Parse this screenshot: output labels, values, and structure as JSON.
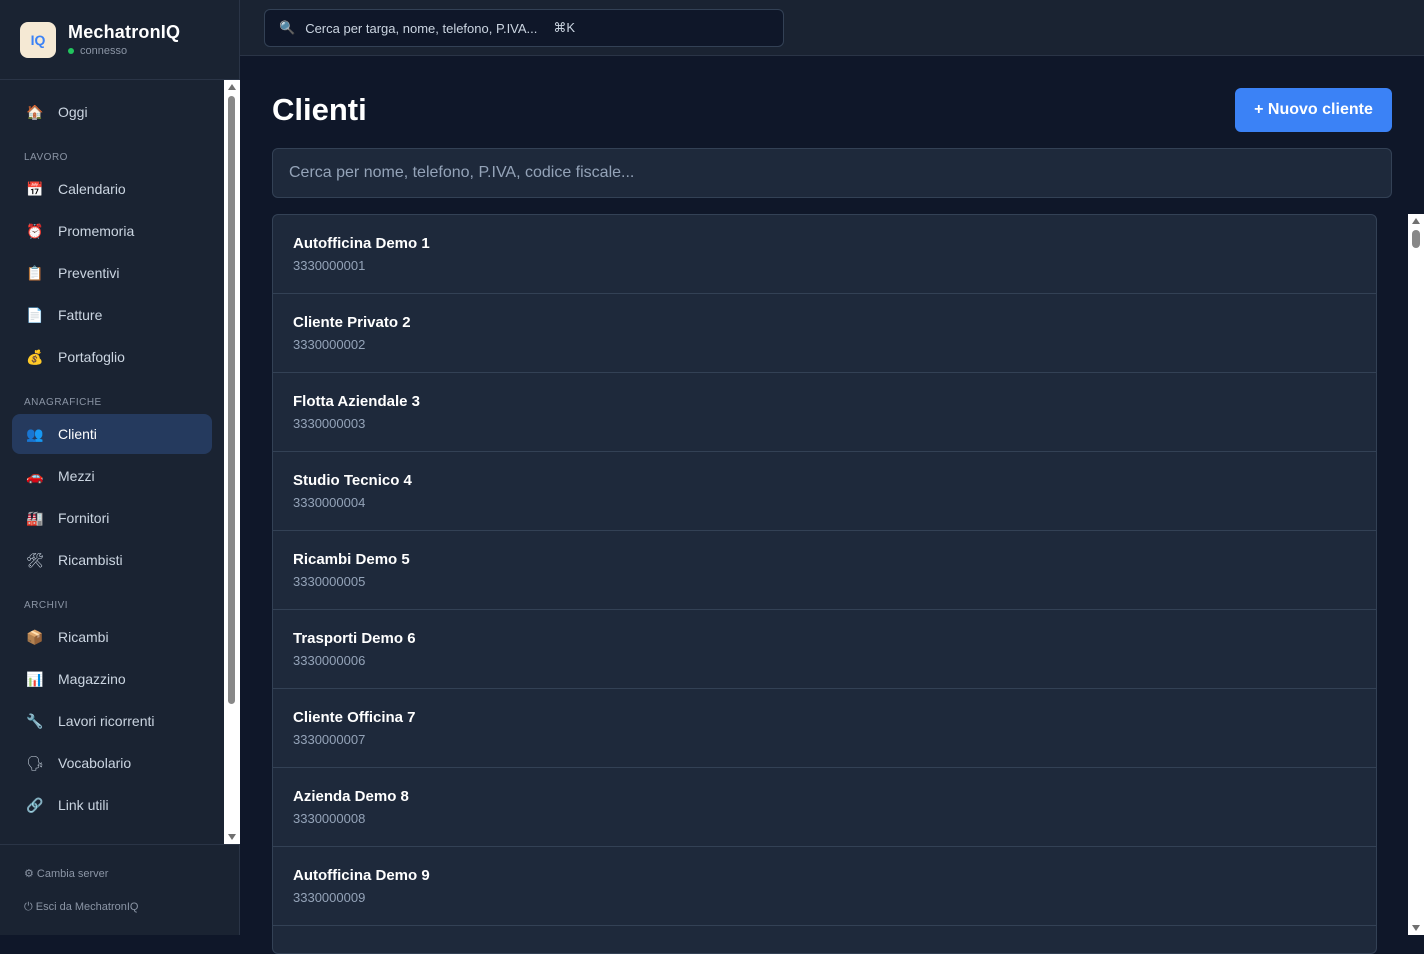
{
  "brand": {
    "name": "MechatronIQ",
    "status": "connesso",
    "logo_text": "IQ"
  },
  "sidebar": {
    "top_item": {
      "label": "Oggi",
      "icon": "🏠",
      "icon_name": "home-icon"
    },
    "sections": [
      {
        "title": "LAVORO",
        "items": [
          {
            "label": "Calendario",
            "icon": "📅",
            "icon_name": "calendar-icon"
          },
          {
            "label": "Promemoria",
            "icon": "⏰",
            "icon_name": "alarm-clock-icon"
          },
          {
            "label": "Preventivi",
            "icon": "📋",
            "icon_name": "clipboard-icon"
          },
          {
            "label": "Fatture",
            "icon": "📄",
            "icon_name": "invoice-icon"
          },
          {
            "label": "Portafoglio",
            "icon": "💰",
            "icon_name": "money-bag-icon"
          }
        ]
      },
      {
        "title": "ANAGRAFICHE",
        "items": [
          {
            "label": "Clienti",
            "icon": "👥",
            "icon_name": "users-icon",
            "active": true
          },
          {
            "label": "Mezzi",
            "icon": "🚗",
            "icon_name": "car-icon"
          },
          {
            "label": "Fornitori",
            "icon": "🏭",
            "icon_name": "factory-icon"
          },
          {
            "label": "Ricambisti",
            "icon": "🛠",
            "icon_name": "tools-icon"
          }
        ]
      },
      {
        "title": "ARCHIVI",
        "items": [
          {
            "label": "Ricambi",
            "icon": "📦",
            "icon_name": "package-icon"
          },
          {
            "label": "Magazzino",
            "icon": "📊",
            "icon_name": "bar-chart-icon"
          },
          {
            "label": "Lavori ricorrenti",
            "icon": "🔧",
            "icon_name": "wrench-icon"
          },
          {
            "label": "Vocabolario",
            "icon": "🗣",
            "icon_name": "speaking-head-icon"
          },
          {
            "label": "Link utili",
            "icon": "🔗",
            "icon_name": "link-icon"
          }
        ]
      }
    ],
    "footer": {
      "change_server": "⚙ Cambia server",
      "logout": "⏻ Esci da MechatronIQ"
    }
  },
  "topbar": {
    "search_placeholder": "Cerca per targa, nome, telefono, P.IVA...",
    "search_icon": "🔍",
    "shortcut": "⌘K"
  },
  "main": {
    "title": "Clienti",
    "new_button": "+ Nuovo cliente",
    "search_placeholder": "Cerca per nome, telefono, P.IVA, codice fiscale...",
    "clients": [
      {
        "name": "Autofficina Demo 1",
        "phone": "3330000001"
      },
      {
        "name": "Cliente Privato 2",
        "phone": "3330000002"
      },
      {
        "name": "Flotta Aziendale 3",
        "phone": "3330000003"
      },
      {
        "name": "Studio Tecnico 4",
        "phone": "3330000004"
      },
      {
        "name": "Ricambi Demo 5",
        "phone": "3330000005"
      },
      {
        "name": "Trasporti Demo 6",
        "phone": "3330000006"
      },
      {
        "name": "Cliente Officina 7",
        "phone": "3330000007"
      },
      {
        "name": "Azienda Demo 8",
        "phone": "3330000008"
      },
      {
        "name": "Autofficina Demo 9",
        "phone": "3330000009"
      }
    ]
  }
}
